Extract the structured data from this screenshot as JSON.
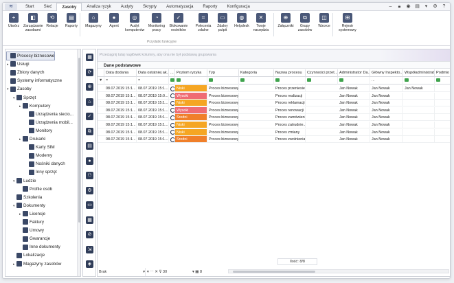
{
  "menu": {
    "home_icon": "menu-icon",
    "tabs": [
      "Start",
      "Sieć",
      "Zasoby",
      "Analiza ryzyk",
      "Audyty",
      "Skrypty",
      "Automatyzacja",
      "Raporty",
      "Konfiguracja"
    ],
    "active_tab": "Zasoby"
  },
  "ribbon": {
    "buttons": [
      {
        "label": "Utwórz",
        "icon": "add-icon"
      },
      {
        "label": "Zarządzanie zasobami",
        "icon": "resources-icon"
      },
      {
        "label": "Relacje",
        "icon": "relations-icon"
      },
      {
        "label": "Raporty",
        "icon": "report-icon"
      },
      {
        "label": "Magazyny",
        "icon": "warehouse-icon"
      },
      {
        "label": "Agent",
        "icon": "agent-icon"
      },
      {
        "label": "Audyt komputerów",
        "icon": "audit-icon"
      },
      {
        "label": "Monitoring pracy",
        "icon": "monitoring-icon"
      },
      {
        "label": "Blokowanie nośników",
        "icon": "shield-icon"
      },
      {
        "label": "Polecenia zdalne",
        "icon": "terminal-icon"
      },
      {
        "label": "Zdalny pulpit",
        "icon": "desktop-icon"
      },
      {
        "label": "Helpdesk",
        "icon": "lifebuoy-icon"
      },
      {
        "label": "Twoje narzędzia",
        "icon": "tools-icon"
      },
      {
        "label": "Załączniki",
        "icon": "attachment-icon"
      },
      {
        "label": "Grupy zasobów",
        "icon": "groups-icon"
      },
      {
        "label": "Wzorce",
        "icon": "patterns-icon"
      },
      {
        "label": "Rejestr systemowy",
        "icon": "registry-icon"
      }
    ],
    "group_label": "Przydatki funkcyjne"
  },
  "tree": {
    "items": [
      {
        "label": "Procesy biznesowe",
        "level": 0,
        "selected": true,
        "icon": "process-icon"
      },
      {
        "label": "Usługi",
        "level": 0,
        "icon": "gear-icon",
        "expand": "▸"
      },
      {
        "label": "Zbiory danych",
        "level": 0,
        "icon": "data-icon"
      },
      {
        "label": "Systemy informatyczne",
        "level": 0,
        "icon": "system-icon"
      },
      {
        "label": "Zasoby",
        "level": 0,
        "icon": "folder-icon",
        "expand": "▾"
      },
      {
        "label": "Sprzęt",
        "level": 1,
        "icon": "hardware-icon",
        "expand": "▾"
      },
      {
        "label": "Komputery",
        "level": 2,
        "icon": "computer-icon",
        "expand": "▸"
      },
      {
        "label": "Urządzenia siecio...",
        "level": 3,
        "icon": "network-icon"
      },
      {
        "label": "Urządzenia mobil...",
        "level": 3,
        "icon": "mobile-icon"
      },
      {
        "label": "Monitory",
        "level": 3,
        "icon": "monitor-icon"
      },
      {
        "label": "Drukarki",
        "level": 2,
        "icon": "printer-icon",
        "expand": "▸"
      },
      {
        "label": "Karty SIM",
        "level": 3,
        "icon": "sim-icon"
      },
      {
        "label": "Modemy",
        "level": 3,
        "icon": "modem-icon"
      },
      {
        "label": "Nośniki danych",
        "level": 3,
        "icon": "storage-icon"
      },
      {
        "label": "Inny sprzęt",
        "level": 3,
        "icon": "other-hardware-icon"
      },
      {
        "label": "Ludzie",
        "level": 1,
        "icon": "people-icon",
        "expand": "▾"
      },
      {
        "label": "Profile osób",
        "level": 2,
        "icon": "person-icon"
      },
      {
        "label": "Szkolenia",
        "level": 1,
        "icon": "training-icon"
      },
      {
        "label": "Dokumenty",
        "level": 1,
        "icon": "documents-icon",
        "expand": "▾"
      },
      {
        "label": "Licencje",
        "level": 2,
        "icon": "license-icon",
        "expand": "▸"
      },
      {
        "label": "Faktury",
        "level": 2,
        "icon": "invoice-icon"
      },
      {
        "label": "Umowy",
        "level": 2,
        "icon": "contract-icon"
      },
      {
        "label": "Gwarancje",
        "level": 2,
        "icon": "warranty-icon"
      },
      {
        "label": "Inne dokumenty",
        "level": 2,
        "icon": "document-icon"
      },
      {
        "label": "Lokalizacje",
        "level": 1,
        "icon": "location-icon"
      },
      {
        "label": "Magazyny zasobów",
        "level": 1,
        "icon": "warehouse-icon",
        "expand": "▸"
      }
    ]
  },
  "vbar": {
    "icons": [
      "grid-view-icon",
      "refresh-icon",
      "globe-icon",
      "home-icon",
      "check-shield-icon",
      "copy-icon",
      "document-icon",
      "user-icon",
      "users-icon",
      "settings-icon",
      "computer-icon",
      "table-icon",
      "link-icon",
      "export-icon",
      "tag-icon"
    ]
  },
  "grid": {
    "group_hint": "Przeciągnij tutaj nagłówek kolumny, aby ona nie był podstawą grupowania",
    "band": "Dane podstawowe",
    "columns": [
      "Data dodania",
      "Data ostatniej ak...",
      "...",
      "Poziom ryzyka",
      "Typ",
      "Kategoria",
      "Nazwa procesu",
      "Czynności przet...",
      "Administrator Da...",
      "Główny Inspekto...",
      "Współadministrat...",
      "Podmio"
    ],
    "filter_row": [
      "=",
      "=",
      "",
      "",
      "",
      "",
      "",
      "",
      "",
      "...",
      "",
      ""
    ],
    "rows": [
      {
        "added": "08.07.2019 15:1...",
        "last": "08.07.2019 15:1...",
        "risk": "Niski",
        "risk_color": "#f5a623",
        "type": "Proces biznesowy",
        "name": "Proces przeniesie...",
        "admin": "Jan Nowak",
        "inspector": "Jan Nowak",
        "coadmin": "Jan Nowak"
      },
      {
        "added": "08.07.2019 15:1...",
        "last": "08.07.2019 15:0...",
        "risk": "Wysoki",
        "risk_color": "#ef6c73",
        "type": "Proces biznesowy",
        "name": "Proces realizacji",
        "admin": "Jan Nowak",
        "inspector": "Jan Nowak",
        "coadmin": ""
      },
      {
        "added": "08.07.2019 15:1...",
        "last": "08.07.2019 15:1...",
        "risk": "Niski",
        "risk_color": "#f5a623",
        "type": "Proces biznesowy",
        "name": "Proces reklamacji",
        "admin": "Jan Nowak",
        "inspector": "Jan Nowak",
        "coadmin": ""
      },
      {
        "added": "08.07.2019 15:1...",
        "last": "08.07.2019 15:1...",
        "risk": "Wysoki",
        "risk_color": "#ef6c73",
        "type": "Proces biznesowy",
        "name": "Proces renowacji",
        "admin": "Jan Nowak",
        "inspector": "Jan Nowak",
        "coadmin": ""
      },
      {
        "added": "08.07.2019 15:1...",
        "last": "08.07.2019 15:1...",
        "risk": "Średni",
        "risk_color": "#f07f2a",
        "type": "Proces biznesowy",
        "name": "Proces zamówienia",
        "admin": "Jan Nowak",
        "inspector": "Jan Nowak",
        "coadmin": ""
      },
      {
        "added": "08.07.2019 15:1...",
        "last": "08.07.2019 15:1...",
        "risk": "Niski",
        "risk_color": "#f5a623",
        "type": "Proces biznesowy",
        "name": "Proces zatrudnie...",
        "admin": "Jan Nowak",
        "inspector": "Jan Nowak",
        "coadmin": ""
      },
      {
        "added": "08.07.2019 15:1...",
        "last": "08.07.2019 15:1...",
        "risk": "Niski",
        "risk_color": "#f5a623",
        "type": "Proces biznesowy",
        "name": "Proces zmiany",
        "admin": "Jan Nowak",
        "inspector": "Jan Nowak",
        "coadmin": ""
      },
      {
        "added": "08.07.2019 15:1...",
        "last": "08.07.2019 15:1...",
        "risk": "Średni",
        "risk_color": "#f07f2a",
        "type": "Proces biznesowy",
        "name": "Proces zwolnienia",
        "admin": "Jan Nowak",
        "inspector": "Jan Nowak",
        "coadmin": ""
      }
    ],
    "summary": "Ilość: 8/8",
    "footer_group": "Brak",
    "footer_filter": "30",
    "footer_page": "8"
  }
}
